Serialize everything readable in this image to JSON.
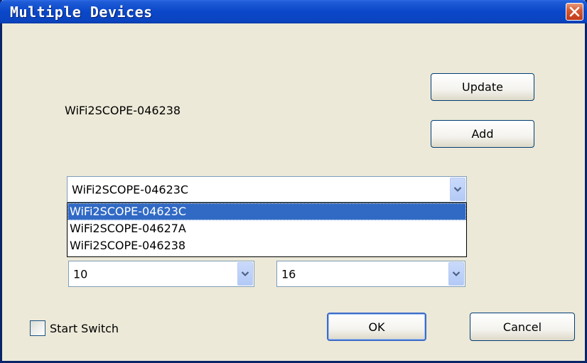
{
  "window": {
    "title": "Multiple Devices",
    "close_icon": "close-icon"
  },
  "current_device": "WiFi2SCOPE-046238",
  "buttons": {
    "update": "Update",
    "add": "Add",
    "ok": "OK",
    "cancel": "Cancel"
  },
  "device_combo": {
    "selected": "WiFi2SCOPE-04623C",
    "options": [
      "WiFi2SCOPE-04623C",
      "WiFi2SCOPE-04627A",
      "WiFi2SCOPE-046238"
    ]
  },
  "left_combo": {
    "selected": "10"
  },
  "right_combo": {
    "selected": "16"
  },
  "start_switch": {
    "label": "Start Switch",
    "checked": false
  },
  "colors": {
    "title_bar": "#0A47C9",
    "selection": "#316AC5",
    "dialog_bg": "#ECE9D8",
    "close_button": "#D65A32"
  }
}
